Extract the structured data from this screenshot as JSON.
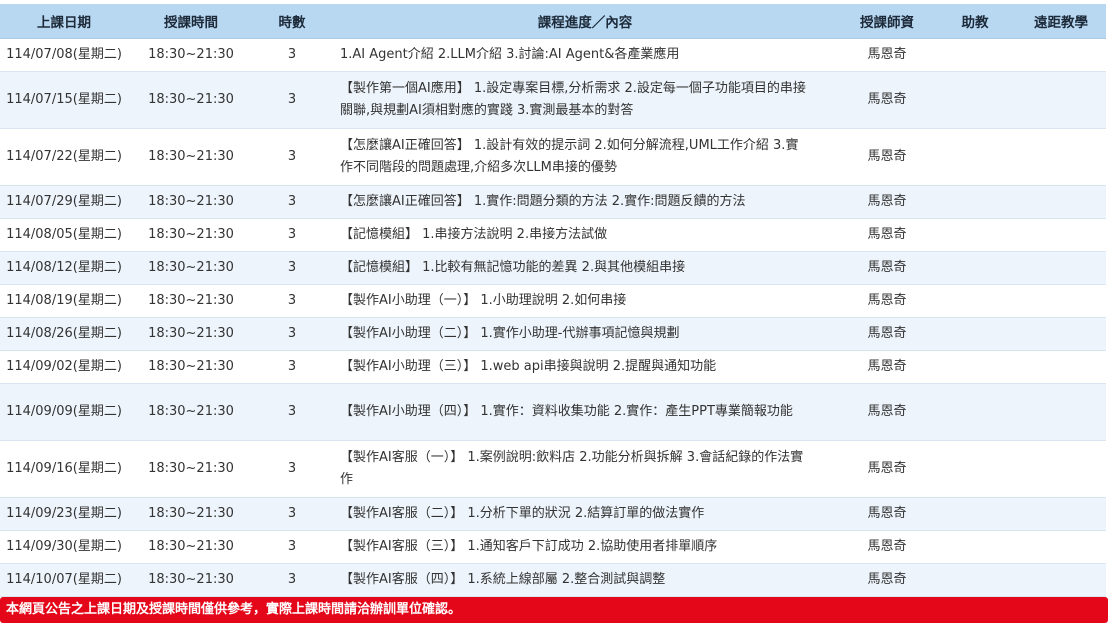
{
  "headers": {
    "date": "上課日期",
    "time": "授課時間",
    "hours": "時數",
    "progress": "課程進度／內容",
    "teacher": "授課師資",
    "assistant": "助教",
    "remote": "遠距教學"
  },
  "rows": [
    {
      "date": "114/07/08(星期二)",
      "time": "18:30~21:30",
      "hours": "3",
      "progress": "1.AI Agent介紹 2.LLM介紹 3.討論:AI Agent&各產業應用",
      "teacher": "馬恩奇",
      "assistant": "",
      "remote": ""
    },
    {
      "date": "114/07/15(星期二)",
      "time": "18:30~21:30",
      "hours": "3",
      "progress": "【製作第一個AI應用】 1.設定專案目標,分析需求 2.設定每一個子功能項目的串接關聯,與規劃AI須相對應的實踐 3.實測最基本的對答",
      "teacher": "馬恩奇",
      "assistant": "",
      "remote": ""
    },
    {
      "date": "114/07/22(星期二)",
      "time": "18:30~21:30",
      "hours": "3",
      "progress": "【怎麼讓AI正確回答】 1.設計有效的提示詞 2.如何分解流程,UML工作介紹 3.實作不同階段的問題處理,介紹多次LLM串接的優勢",
      "teacher": "馬恩奇",
      "assistant": "",
      "remote": ""
    },
    {
      "date": "114/07/29(星期二)",
      "time": "18:30~21:30",
      "hours": "3",
      "progress": "【怎麼讓AI正確回答】 1.實作:問題分類的方法 2.實作:問題反饋的方法",
      "teacher": "馬恩奇",
      "assistant": "",
      "remote": ""
    },
    {
      "date": "114/08/05(星期二)",
      "time": "18:30~21:30",
      "hours": "3",
      "progress": "【記憶模組】 1.串接方法說明 2.串接方法試做",
      "teacher": "馬恩奇",
      "assistant": "",
      "remote": ""
    },
    {
      "date": "114/08/12(星期二)",
      "time": "18:30~21:30",
      "hours": "3",
      "progress": "【記憶模組】 1.比較有無記憶功能的差異 2.與其他模組串接",
      "teacher": "馬恩奇",
      "assistant": "",
      "remote": ""
    },
    {
      "date": "114/08/19(星期二)",
      "time": "18:30~21:30",
      "hours": "3",
      "progress": "【製作AI小助理（一）】 1.小助理說明 2.如何串接",
      "teacher": "馬恩奇",
      "assistant": "",
      "remote": ""
    },
    {
      "date": "114/08/26(星期二)",
      "time": "18:30~21:30",
      "hours": "3",
      "progress": "【製作AI小助理（二）】 1.實作小助理-代辦事項記憶與規劃",
      "teacher": "馬恩奇",
      "assistant": "",
      "remote": ""
    },
    {
      "date": "114/09/02(星期二)",
      "time": "18:30~21:30",
      "hours": "3",
      "progress": "【製作AI小助理（三）】 1.web api串接與說明 2.提醒與通知功能",
      "teacher": "馬恩奇",
      "assistant": "",
      "remote": ""
    },
    {
      "date": "114/09/09(星期二)",
      "time": "18:30~21:30",
      "hours": "3",
      "progress": "【製作AI小助理（四）】 1.實作：資料收集功能 2.實作：產生PPT專業簡報功能",
      "teacher": "馬恩奇",
      "assistant": "",
      "remote": ""
    },
    {
      "date": "114/09/16(星期二)",
      "time": "18:30~21:30",
      "hours": "3",
      "progress": "【製作AI客服（一）】 1.案例說明:飲料店 2.功能分析與拆解 3.會話紀錄的作法實作",
      "teacher": "馬恩奇",
      "assistant": "",
      "remote": ""
    },
    {
      "date": "114/09/23(星期二)",
      "time": "18:30~21:30",
      "hours": "3",
      "progress": "【製作AI客服（二）】 1.分析下單的狀況 2.結算訂單的做法實作",
      "teacher": "馬恩奇",
      "assistant": "",
      "remote": ""
    },
    {
      "date": "114/09/30(星期二)",
      "time": "18:30~21:30",
      "hours": "3",
      "progress": "【製作AI客服（三）】 1.通知客戶下訂成功 2.協助使用者排單順序",
      "teacher": "馬恩奇",
      "assistant": "",
      "remote": ""
    },
    {
      "date": "114/10/07(星期二)",
      "time": "18:30~21:30",
      "hours": "3",
      "progress": "【製作AI客服（四）】 1.系統上線部屬 2.整合測試與調整",
      "teacher": "馬恩奇",
      "assistant": "",
      "remote": ""
    }
  ],
  "notice": "本網頁公告之上課日期及授課時間僅供參考，實際上課時間請洽辦訓單位確認。"
}
